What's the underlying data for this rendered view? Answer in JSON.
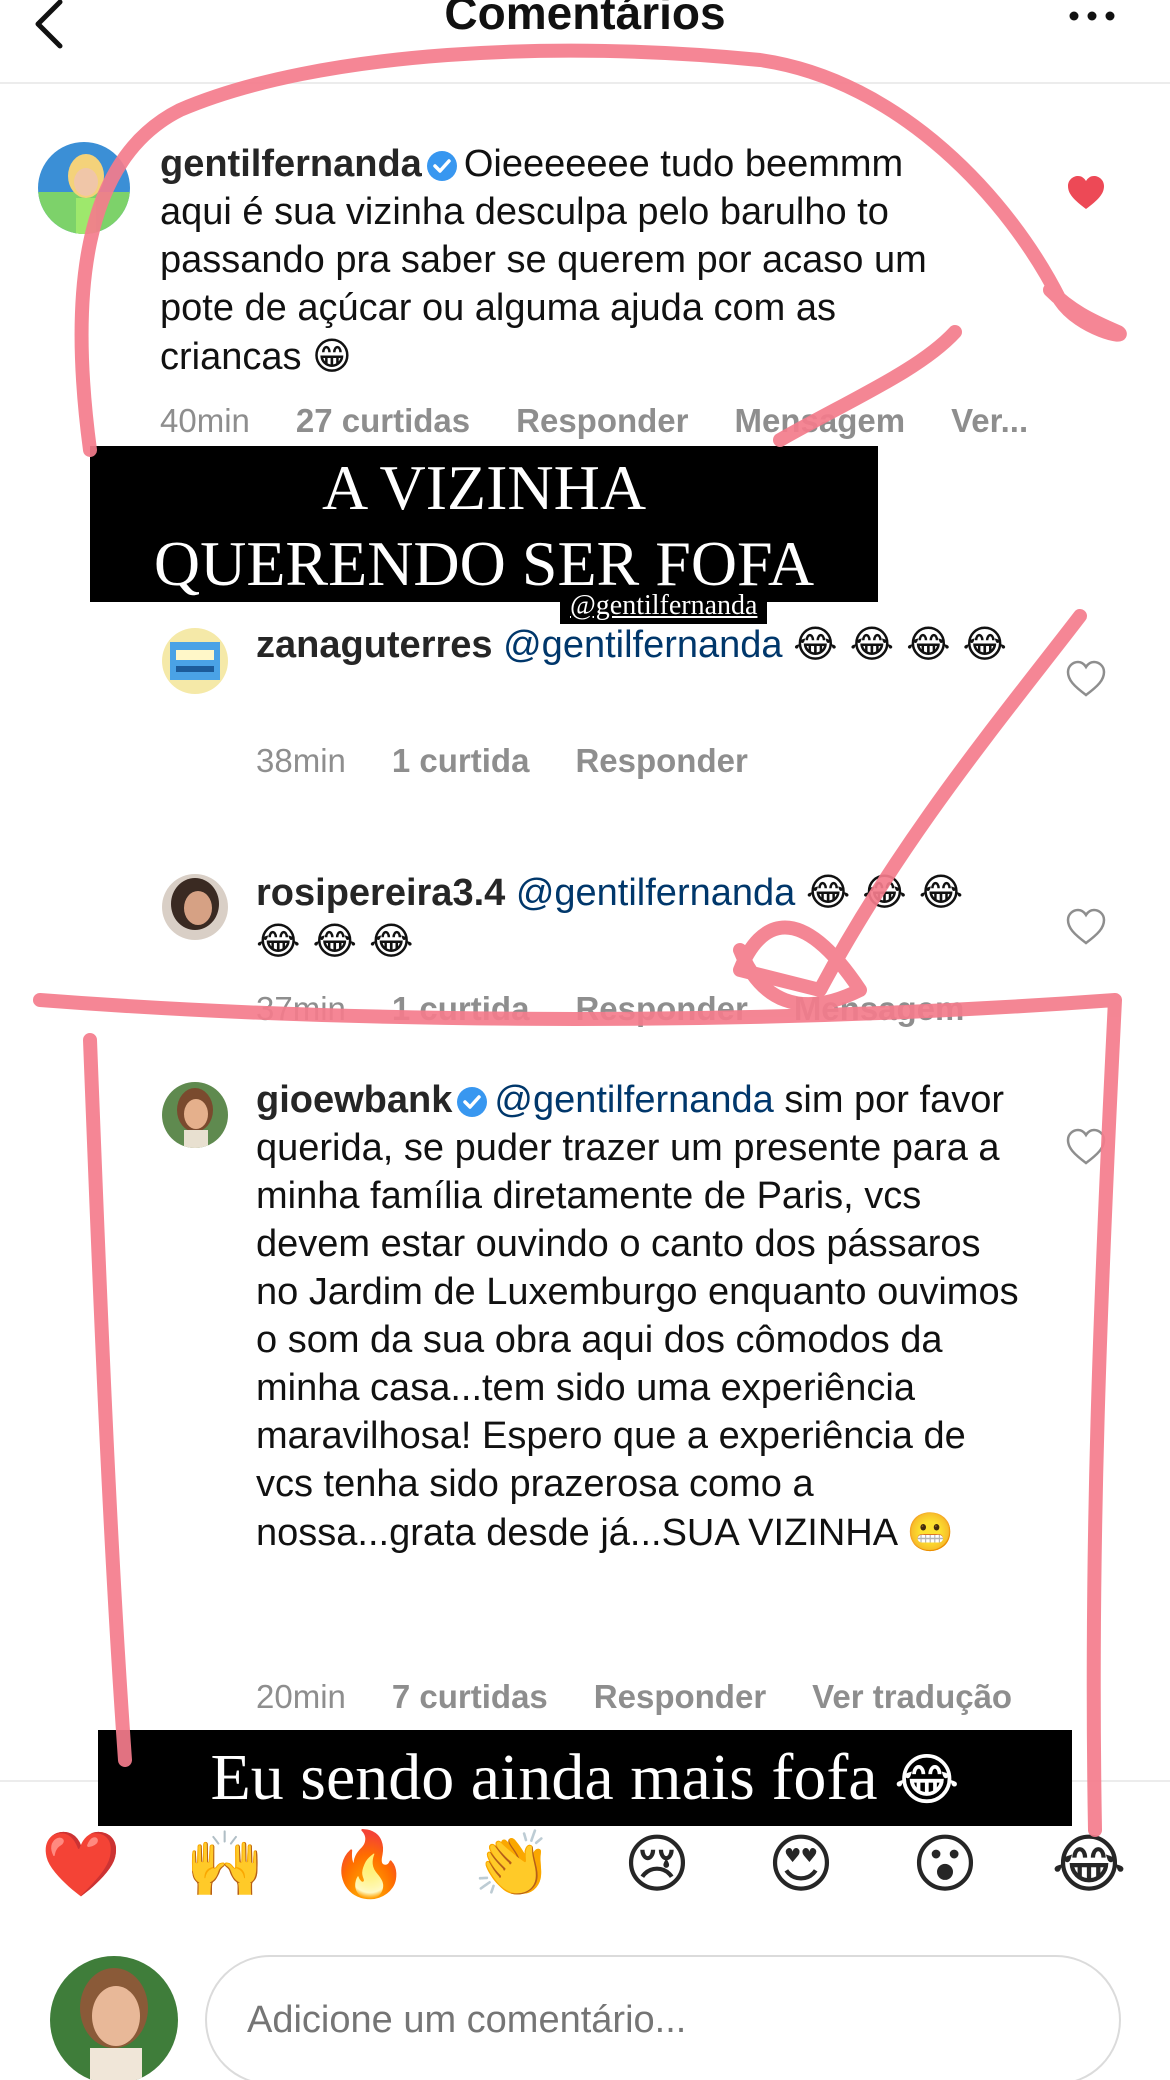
{
  "header": {
    "title": "Comentários",
    "back_icon": "chevron-left-icon",
    "more_icon": "more-horizontal-icon"
  },
  "comments": [
    {
      "username": "gentilfernanda",
      "verified": true,
      "text": "Oieeeeeee tudo beemmm aqui é sua vizinha desculpa pelo barulho to passando pra saber se querem por acaso um pote de açúcar ou alguma ajuda com as criancas",
      "emoji": "😁",
      "time": "40min",
      "likes": "27 curtidas",
      "reply": "Responder",
      "message": "Mensagem",
      "see": "Ver...",
      "liked": true
    },
    {
      "username": "zanaguterres",
      "mention": "@gentilfernanda",
      "emoji": "😂 😂 😂 😂",
      "time": "38min",
      "likes": "1 curtida",
      "reply": "Responder"
    },
    {
      "username": "rosipereira3.4",
      "mention": "@gentilfernanda",
      "emoji": "😂 😂 😂 😂 😂 😂",
      "time": "37min",
      "likes": "1 curtida",
      "reply": "Responder",
      "message": "Mensagem"
    },
    {
      "username": "gioewbank",
      "verified": true,
      "mention": "@gentilfernanda",
      "text": "sim por favor querida, se puder trazer um presente para a minha família diretamente de Paris, vcs devem estar ouvindo o canto dos pássaros no Jardim de Luxemburgo enquanto ouvimos o som da sua obra aqui dos cômodos da minha casa...tem sido uma experiência maravilhosa! Espero que a experiência de vcs tenha sido prazerosa como a nossa...grata desde já...SUA VIZINHA",
      "emoji": "😬",
      "time": "20min",
      "likes": "7 curtidas",
      "reply": "Responder",
      "translate": "Ver tradução"
    }
  ],
  "story_overlays": {
    "label1": "A VIZINHA QUERENDO SER FOFA",
    "tag": "@gentilfernanda",
    "label2": "Eu sendo ainda mais fofa",
    "label2_emoji": "😂",
    "scribble_color": "#f47c8c"
  },
  "reactions": [
    "❤️",
    "🙌",
    "🔥",
    "👏",
    "😢",
    "😍",
    "😮",
    "😂"
  ],
  "composer": {
    "placeholder": "Adicione um comentário..."
  },
  "colors": {
    "mention": "#00376b",
    "liked_heart": "#ed4956",
    "meta": "#8e8e8e"
  }
}
